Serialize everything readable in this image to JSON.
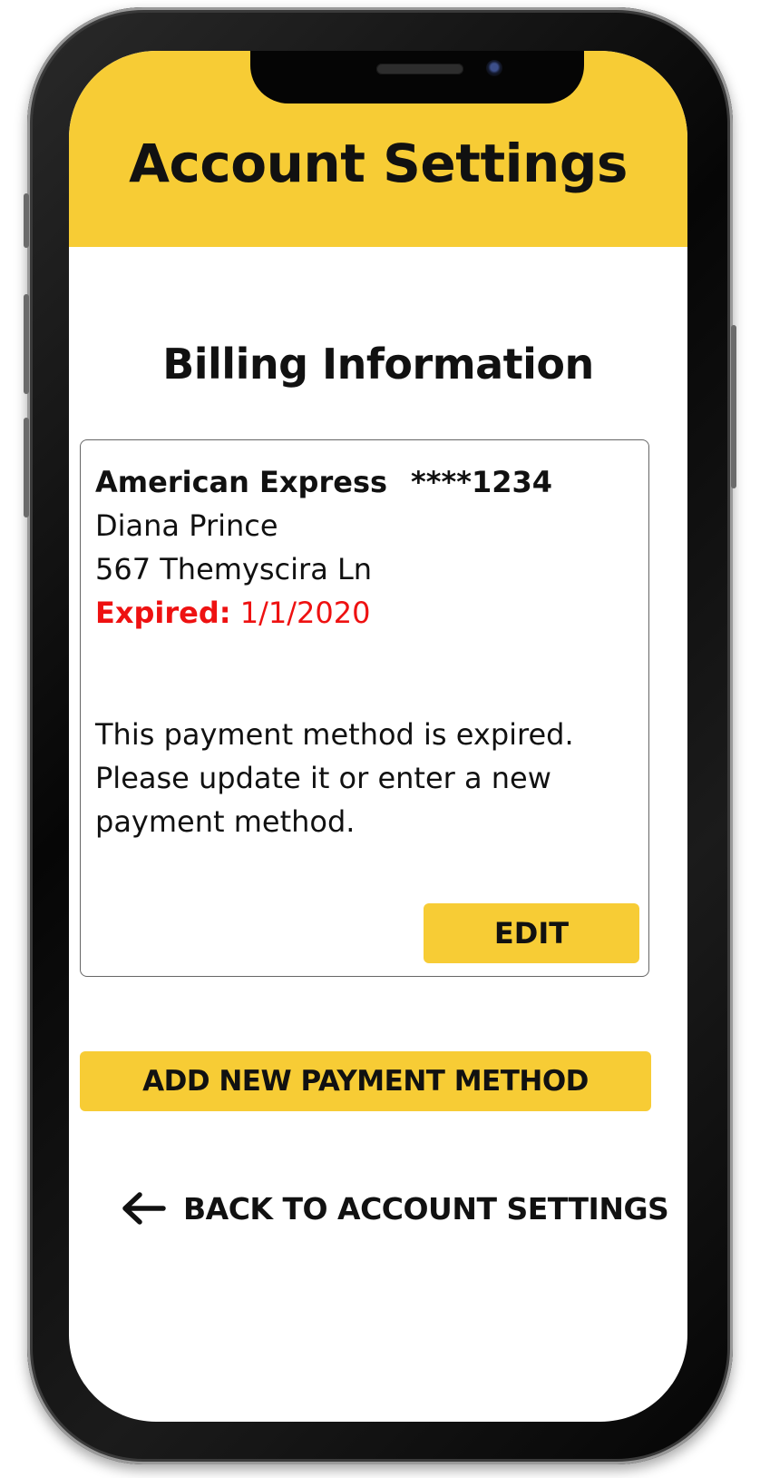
{
  "header": {
    "title": "Account Settings"
  },
  "page": {
    "section_title": "Billing Information"
  },
  "card": {
    "brand": "American Express",
    "number": "****1234",
    "name": "Diana Prince",
    "address": "567 Themyscira Ln",
    "expired_label": "Expired:",
    "expired_date": "1/1/2020",
    "message": "This payment method is expired. Please update it or enter a new payment method.",
    "edit_label": "EDIT"
  },
  "actions": {
    "add_label": "ADD NEW PAYMENT METHOD",
    "back_label": "BACK TO ACCOUNT SETTINGS",
    "back_icon": "arrow-left-icon"
  },
  "colors": {
    "accent": "#f7cc35",
    "error": "#ee1111",
    "text": "#111111"
  }
}
